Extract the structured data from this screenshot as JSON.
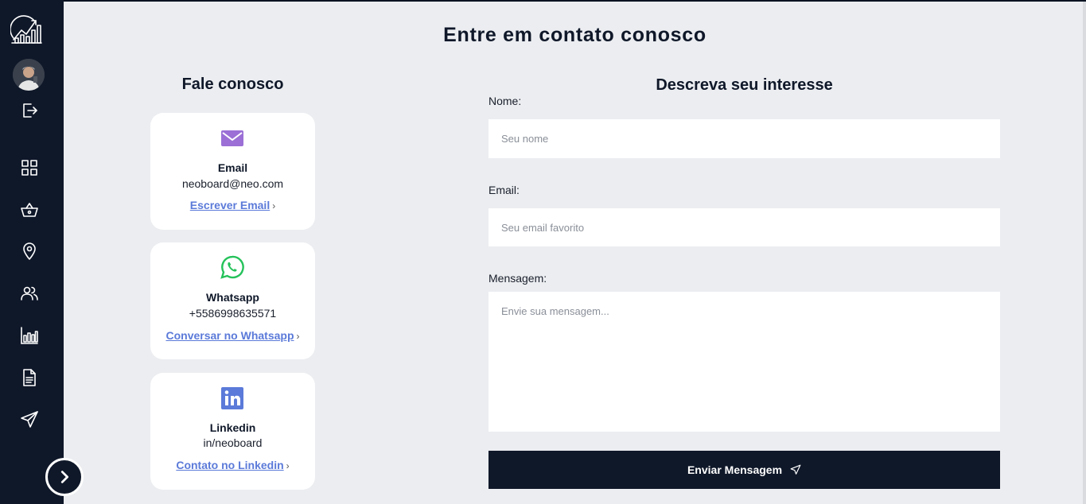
{
  "page": {
    "title": "Entre em contato conosco"
  },
  "contact": {
    "title": "Fale conosco",
    "cards": [
      {
        "title": "Email",
        "value": "neoboard@neo.com",
        "link": "Escrever Email",
        "icon": "envelope-icon",
        "icon_color": "#9b6fd6"
      },
      {
        "title": "Whatsapp",
        "value": "+5586998635571",
        "link": "Conversar no Whatsapp",
        "icon": "whatsapp-icon",
        "icon_color": "#25c25a"
      },
      {
        "title": "Linkedin",
        "value": "in/neoboard",
        "link": "Contato no Linkedin",
        "icon": "linkedin-icon",
        "icon_color": "#5b7ad9"
      }
    ]
  },
  "form": {
    "title": "Descreva seu interesse",
    "name_label": "Nome:",
    "name_placeholder": "Seu nome",
    "email_label": "Email:",
    "email_placeholder": "Seu email favorito",
    "message_label": "Mensagem:",
    "message_placeholder": "Envie sua mensagem...",
    "submit_label": "Enviar Mensagem"
  },
  "sidebar": {
    "icons": [
      "logo-icon",
      "avatar",
      "logout-icon",
      "dashboard-icon",
      "basket-icon",
      "location-pin-icon",
      "users-icon",
      "bar-chart-icon",
      "document-icon",
      "send-icon",
      "chevron-right-icon"
    ]
  },
  "colors": {
    "sidebar": "#0f1829",
    "background": "#ebedf0",
    "link": "#5b7ad9",
    "button": "#0f1829"
  }
}
